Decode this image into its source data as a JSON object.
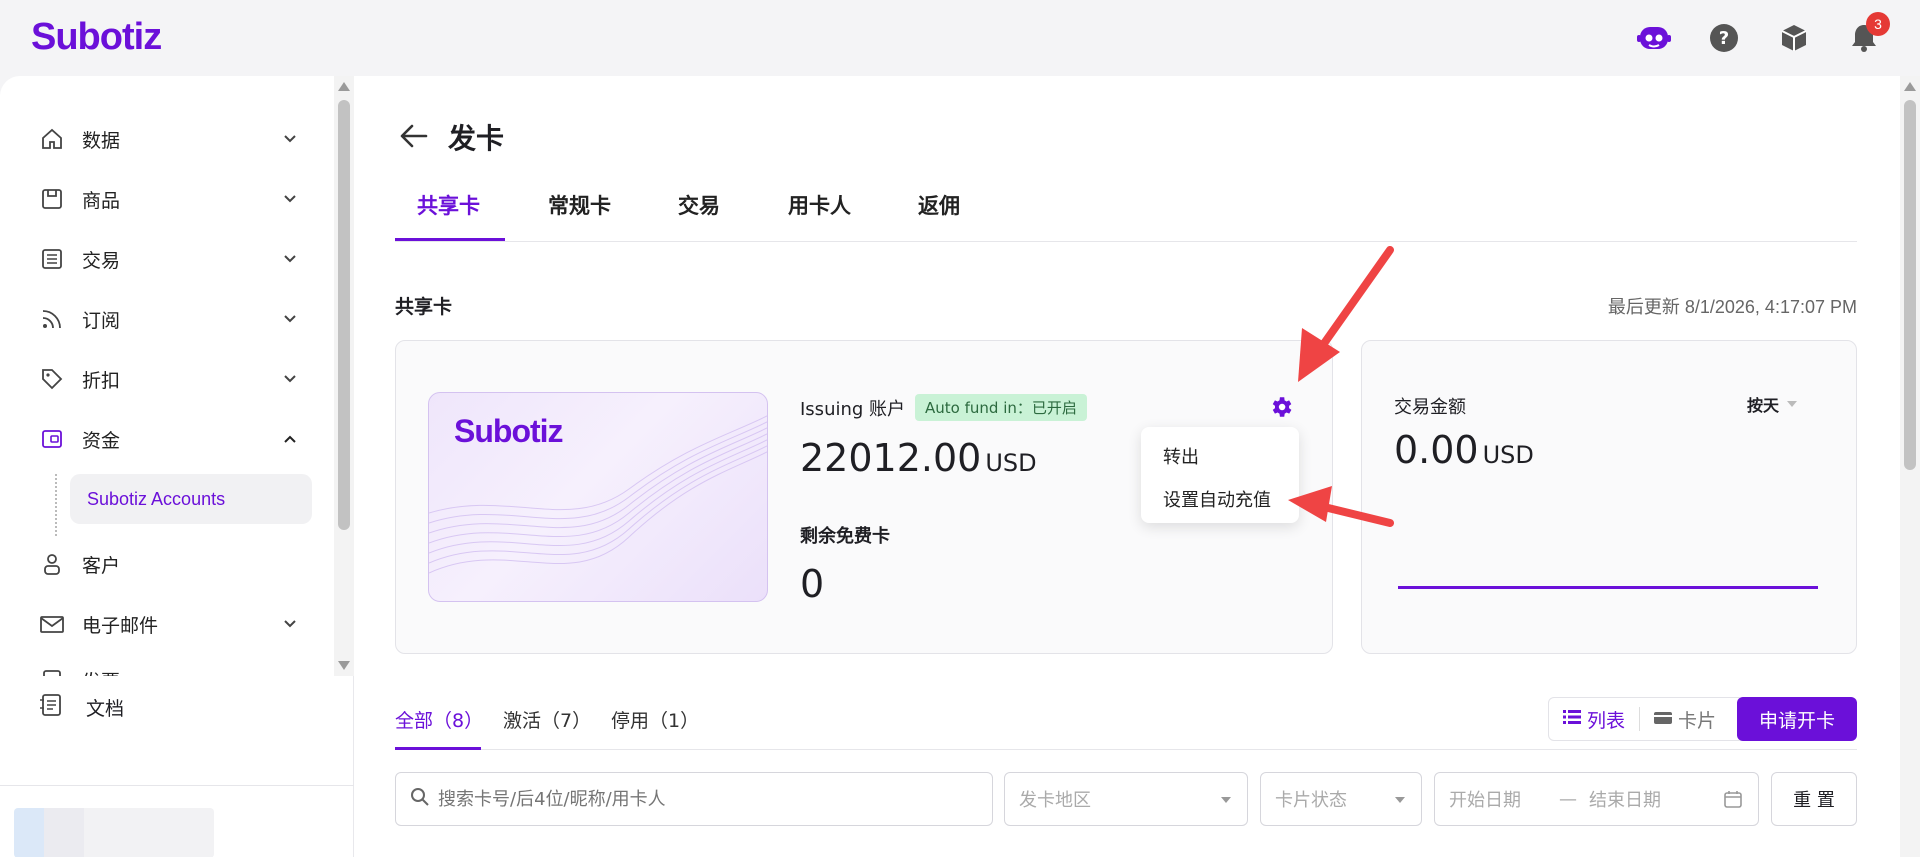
{
  "app": {
    "logo": "Subotiz",
    "notification_count": "3"
  },
  "topbar": {
    "icons": [
      "assistant-bot-icon",
      "help-icon",
      "package-icon",
      "bell-icon"
    ]
  },
  "sidebar": {
    "items": [
      {
        "label": "数据",
        "icon": "home-icon",
        "expanded": false
      },
      {
        "label": "商品",
        "icon": "store-icon",
        "expanded": false
      },
      {
        "label": "交易",
        "icon": "list-icon",
        "expanded": false
      },
      {
        "label": "订阅",
        "icon": "rss-icon",
        "expanded": false
      },
      {
        "label": "折扣",
        "icon": "tag-icon",
        "expanded": false
      },
      {
        "label": "资金",
        "icon": "wallet-icon",
        "expanded": true
      },
      {
        "label": "客户",
        "icon": "user-icon",
        "expanded": false
      },
      {
        "label": "电子邮件",
        "icon": "mail-icon",
        "expanded": false
      },
      {
        "label": "发票",
        "icon": "invoice-icon",
        "expanded": false
      }
    ],
    "sub_item": "Subotiz Accounts",
    "docs": "文档"
  },
  "page": {
    "title": "发卡",
    "tabs": [
      "共享卡",
      "常规卡",
      "交易",
      "用卡人",
      "返佣"
    ],
    "active_tab": "共享卡",
    "section_title": "共享卡",
    "last_update": "最后更新 8/1/2026, 4:17:07 PM"
  },
  "account_card": {
    "card_logo": "Subotiz",
    "label": "Issuing 账户",
    "autofund_badge": "Auto fund in：已开启",
    "balance": "22012.00",
    "currency": "USD",
    "free_cards_label": "剩余免费卡",
    "free_cards_value": "0"
  },
  "settings_menu": {
    "items": [
      "转出",
      "设置自动充值"
    ]
  },
  "transaction_card": {
    "label": "交易金额",
    "period_select": "按天",
    "amount": "0.00",
    "currency": "USD"
  },
  "filters": {
    "tabs": [
      "全部（8）",
      "激活（7）",
      "停用（1）"
    ],
    "view_list": "列表",
    "view_card": "卡片",
    "apply_button": "申请开卡",
    "search_placeholder": "搜索卡号/后4位/昵称/用卡人",
    "region_placeholder": "发卡地区",
    "status_placeholder": "卡片状态",
    "start_date": "开始日期",
    "date_sep": "—",
    "end_date": "结束日期",
    "reset_button": "重 置"
  },
  "colors": {
    "brand": "#6b10d9",
    "badge_bg": "#c9f2d6",
    "annotation": "#ef4444"
  }
}
